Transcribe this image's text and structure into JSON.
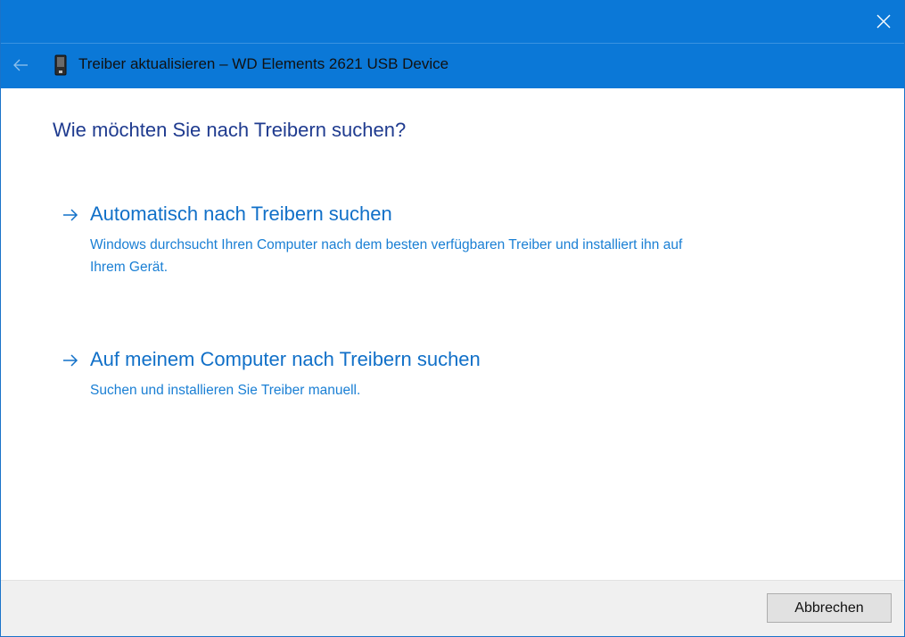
{
  "window": {
    "close_icon": "close-icon"
  },
  "header": {
    "back_icon": "back-arrow-icon",
    "device_icon": "usb-drive-icon",
    "title": "Treiber aktualisieren – WD Elements 2621 USB Device"
  },
  "main": {
    "question": "Wie möchten Sie nach Treibern suchen?",
    "options": [
      {
        "icon": "arrow-right-icon",
        "title": "Automatisch nach Treibern suchen",
        "description": "Windows durchsucht Ihren Computer nach dem besten verfügbaren Treiber und installiert ihn auf Ihrem Gerät."
      },
      {
        "icon": "arrow-right-icon",
        "title": "Auf meinem Computer nach Treibern suchen",
        "description": "Suchen und installieren Sie Treiber manuell."
      }
    ]
  },
  "footer": {
    "cancel_label": "Abbrechen"
  },
  "colors": {
    "titlebar": "#0b78d7",
    "question": "#1f3b8f",
    "link": "#1170c8",
    "link_desc": "#1a7fd4",
    "footer": "#f0f0f0"
  }
}
